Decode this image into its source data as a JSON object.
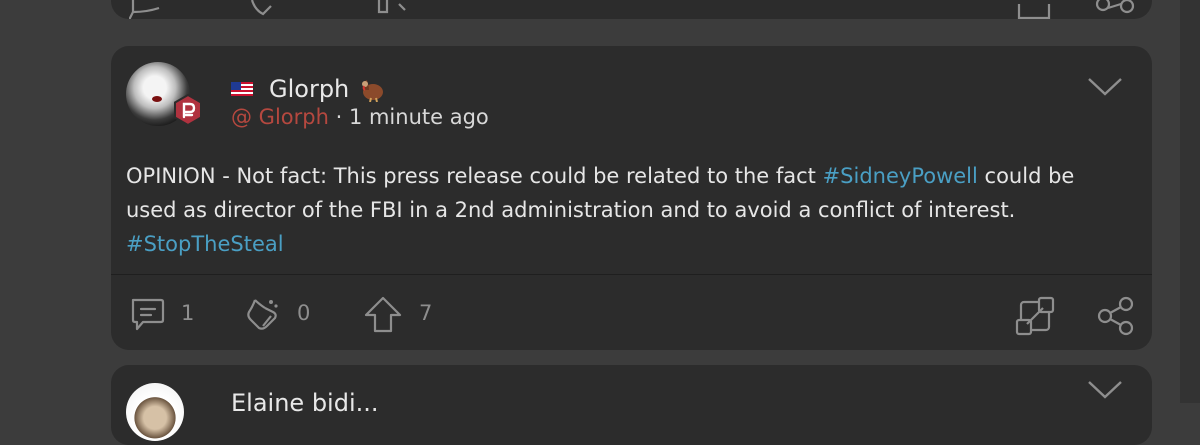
{
  "post": {
    "author": "Glorph",
    "handle": "@ Glorph",
    "separator": " · ",
    "time": "1 minute ago",
    "text_part1": "OPINION - Not fact: This press release could be related to the fact ",
    "hashtag1": "#SidneyPowell",
    "text_part2": " could be used as director of the FBI in a 2nd administration and to avoid a conflict of interest.",
    "hashtag2": "#StopTheSteal",
    "actions": {
      "comments": "1",
      "echoes": "0",
      "upvotes": "7"
    }
  },
  "next_post": {
    "author": "Elaine bidi..."
  },
  "icons": {
    "flag": "us-flag-icon",
    "author_emoji": "turkey-icon",
    "badge": "parler-badge-icon",
    "menu": "chevron-down-icon",
    "comment": "comment-icon",
    "echo": "echo-icon",
    "upvote": "upvote-icon",
    "expand": "expand-icon",
    "share": "share-icon"
  },
  "colors": {
    "background": "#3c3c3c",
    "card": "#2c2c2c",
    "handle": "#b5483f",
    "hashtag": "#4a9fc4",
    "badge": "#b0323f"
  }
}
